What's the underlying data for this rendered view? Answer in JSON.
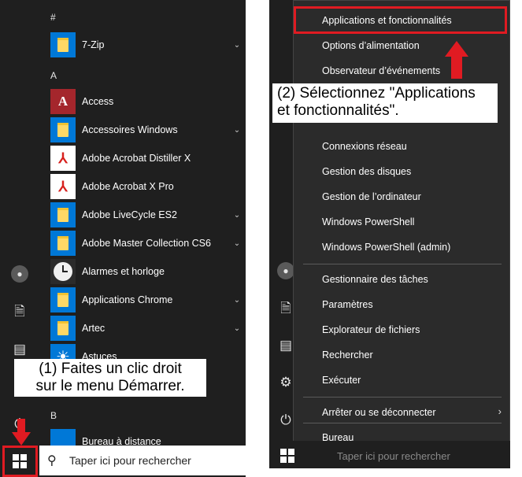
{
  "left_menu": {
    "section_hash": "#",
    "section_a": "A",
    "section_b": "B",
    "apps": [
      {
        "label": "7-Zip",
        "icon": "folder-icon",
        "expandable": true
      },
      {
        "label": "Access",
        "icon": "access-icon",
        "expandable": false
      },
      {
        "label": "Accessoires Windows",
        "icon": "folder-icon",
        "expandable": true
      },
      {
        "label": "Adobe Acrobat Distiller X",
        "icon": "acrobat-icon",
        "expandable": false
      },
      {
        "label": "Adobe Acrobat X Pro",
        "icon": "acrobat-icon",
        "expandable": false
      },
      {
        "label": "Adobe LiveCycle ES2",
        "icon": "folder-icon",
        "expandable": true
      },
      {
        "label": "Adobe Master Collection CS6",
        "icon": "folder-icon",
        "expandable": true
      },
      {
        "label": "Alarmes et horloge",
        "icon": "clock-icon",
        "expandable": false
      },
      {
        "label": "Applications Chrome",
        "icon": "folder-icon",
        "expandable": true
      },
      {
        "label": "Artec",
        "icon": "folder-icon",
        "expandable": true
      },
      {
        "label": "Astuces",
        "icon": "lightbulb-icon",
        "expandable": false
      },
      {
        "label": "Bureau à distance",
        "icon": "remote-desktop-icon",
        "expandable": false
      }
    ],
    "access_letter": "A",
    "acrobat_glyph": "⅄"
  },
  "taskbar": {
    "search_placeholder": "Taper ici pour rechercher"
  },
  "callouts": {
    "step1": "(1) Faites un clic droit sur le menu Démarrer.",
    "step1_line1": "(1) Faites un clic droit",
    "step1_line2": "sur le menu Démarrer.",
    "step2_line1": "(2) Sélectionnez \"Applications",
    "step2_line2": "et fonctionnalités\"."
  },
  "context_menu": {
    "items": [
      {
        "label": "Applications et fonctionnalités",
        "highlighted": true
      },
      {
        "label": "Options d’alimentation"
      },
      {
        "label": "Observateur d’événements"
      },
      {
        "label": "Connexions réseau"
      },
      {
        "label": "Gestion des disques"
      },
      {
        "label": "Gestion de l’ordinateur"
      },
      {
        "label": "Windows PowerShell"
      },
      {
        "label": "Windows PowerShell (admin)"
      },
      {
        "label": "Gestionnaire des tâches"
      },
      {
        "label": "Paramètres"
      },
      {
        "label": "Explorateur de fichiers"
      },
      {
        "label": "Rechercher"
      },
      {
        "label": "Exécuter"
      },
      {
        "label": "Arrêter ou se déconnecter",
        "submenu": true
      },
      {
        "label": "Bureau"
      }
    ]
  },
  "colors": {
    "annotation_red": "#e01b22",
    "tile_blue": "#0078d7",
    "menu_bg": "#2b2b2b",
    "start_bg": "#1f1f1f"
  }
}
